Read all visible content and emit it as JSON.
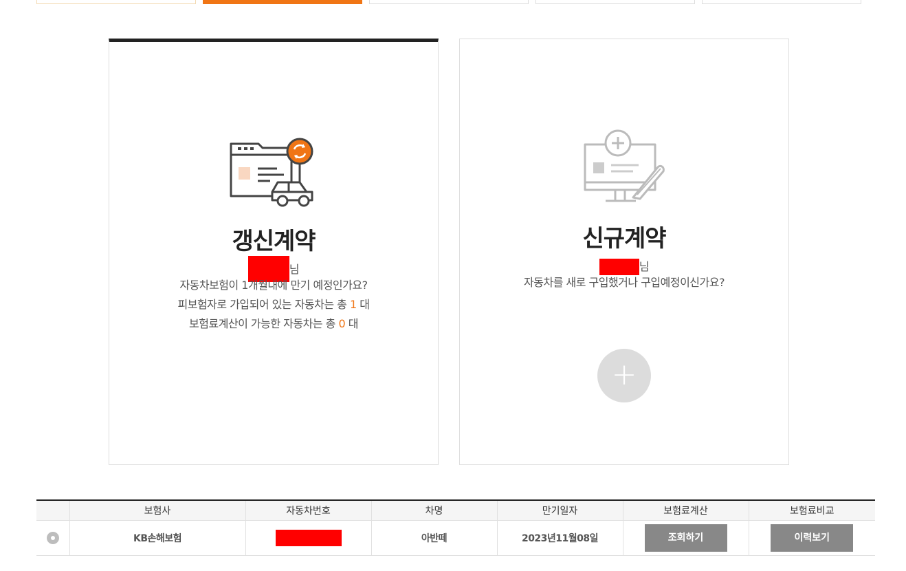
{
  "colors": {
    "accent": "#f07515",
    "redaction": "#ff0000",
    "button_gray": "#888888"
  },
  "renewal": {
    "title": "갱신계약",
    "honorific": "님",
    "line1": "자동차보험이 1개월내에 만기 예정인가요?",
    "line2_prefix": "피보험자로 가입되어 있는 자동차는 총 ",
    "line2_count": "1",
    "line2_suffix": " 대",
    "line3_prefix": "보험료계산이 가능한 자동차는 총 ",
    "line3_count": "0",
    "line3_suffix": " 대",
    "icon": "renewal-car-document-icon"
  },
  "new_contract": {
    "title": "신규계약",
    "honorific": "님",
    "line1": "자동차를 새로 구입했거나 구입예정이신가요?",
    "add_symbol": "+",
    "icon": "new-document-pen-icon"
  },
  "table": {
    "headers": [
      "",
      "보험사",
      "자동차번호",
      "차명",
      "만기일자",
      "보험료계산",
      "보험료비교"
    ],
    "rows": [
      {
        "insurer": "KB손해보험",
        "car_name": "아반떼",
        "expiry": "2023년11월08일",
        "calc_btn": "조회하기",
        "compare_btn": "이력보기"
      }
    ]
  }
}
